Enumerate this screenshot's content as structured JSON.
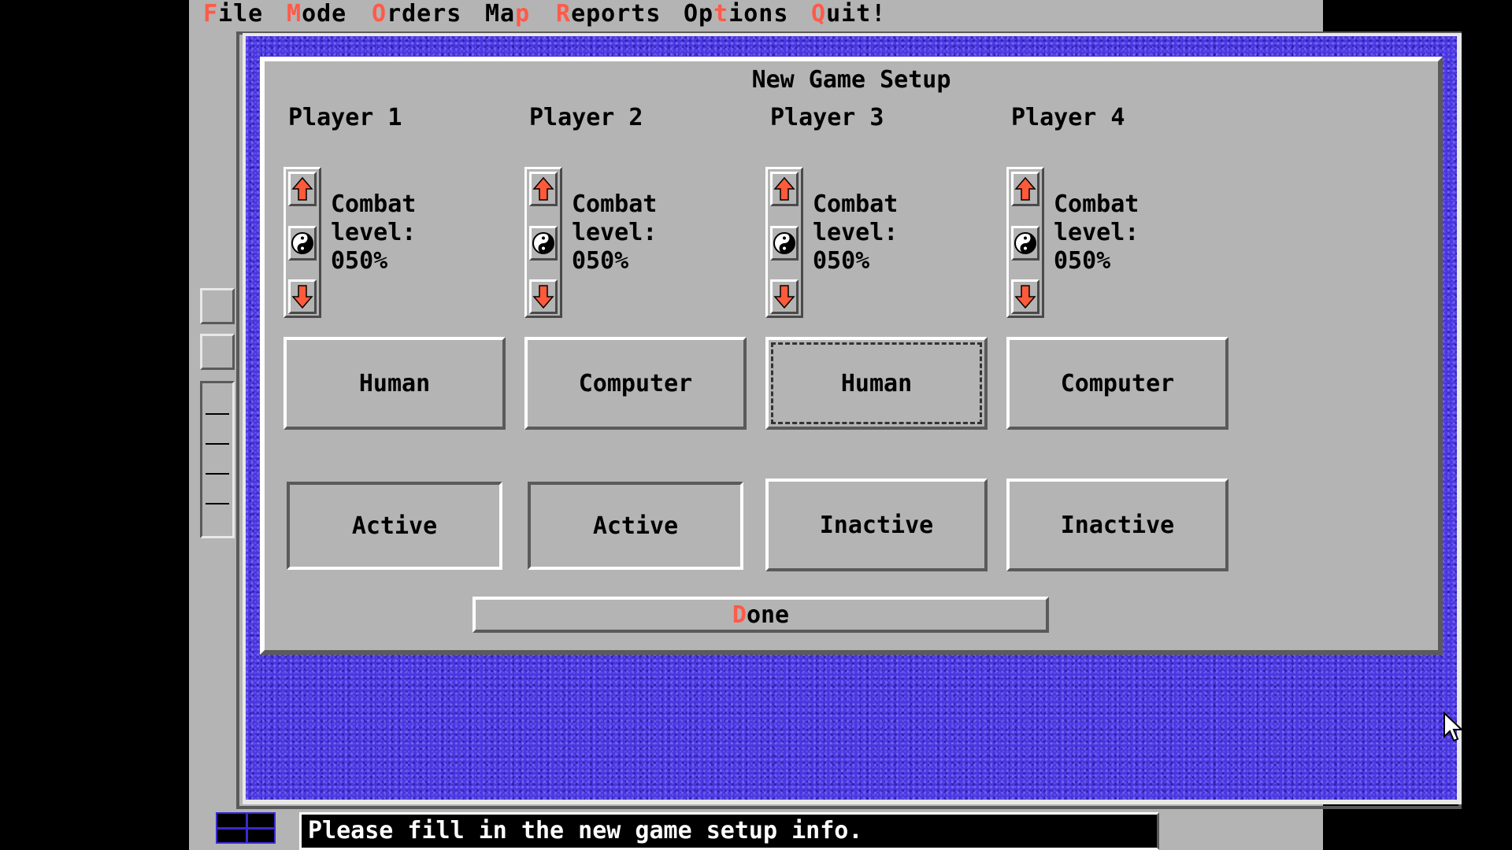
{
  "menu": [
    {
      "hot": "F",
      "rest": "ile"
    },
    {
      "hot": "M",
      "rest": "ode"
    },
    {
      "hot": "O",
      "rest": "rders"
    },
    {
      "hot": "p",
      "pre": "Ma",
      "rest": ""
    },
    {
      "hot": "R",
      "rest": "eports"
    },
    {
      "hot": "t",
      "pre": "Op",
      "rest": "ions"
    },
    {
      "hot": "Q",
      "rest": "uit!"
    }
  ],
  "dialog": {
    "title": "New Game Setup",
    "players": [
      {
        "name": "Player 1",
        "combat_line1": "Combat",
        "combat_line2": "level:",
        "combat_value": "050%",
        "type": "Human",
        "status": "Active"
      },
      {
        "name": "Player 2",
        "combat_line1": "Combat",
        "combat_line2": "level:",
        "combat_value": "050%",
        "type": "Computer",
        "status": "Active"
      },
      {
        "name": "Player 3",
        "combat_line1": "Combat",
        "combat_line2": "level:",
        "combat_value": "050%",
        "type": "Human",
        "status": "Inactive"
      },
      {
        "name": "Player 4",
        "combat_line1": "Combat",
        "combat_line2": "level:",
        "combat_value": "050%",
        "type": "Computer",
        "status": "Inactive"
      }
    ],
    "done_hot": "D",
    "done_rest": "one"
  },
  "statusbar": {
    "message": "Please fill in the new game setup info."
  },
  "colors": {
    "hotkey": "#ff5a4a",
    "water": "#4a36e0",
    "panel": "#b4b4b4",
    "arrow": "#ff5a3a"
  }
}
